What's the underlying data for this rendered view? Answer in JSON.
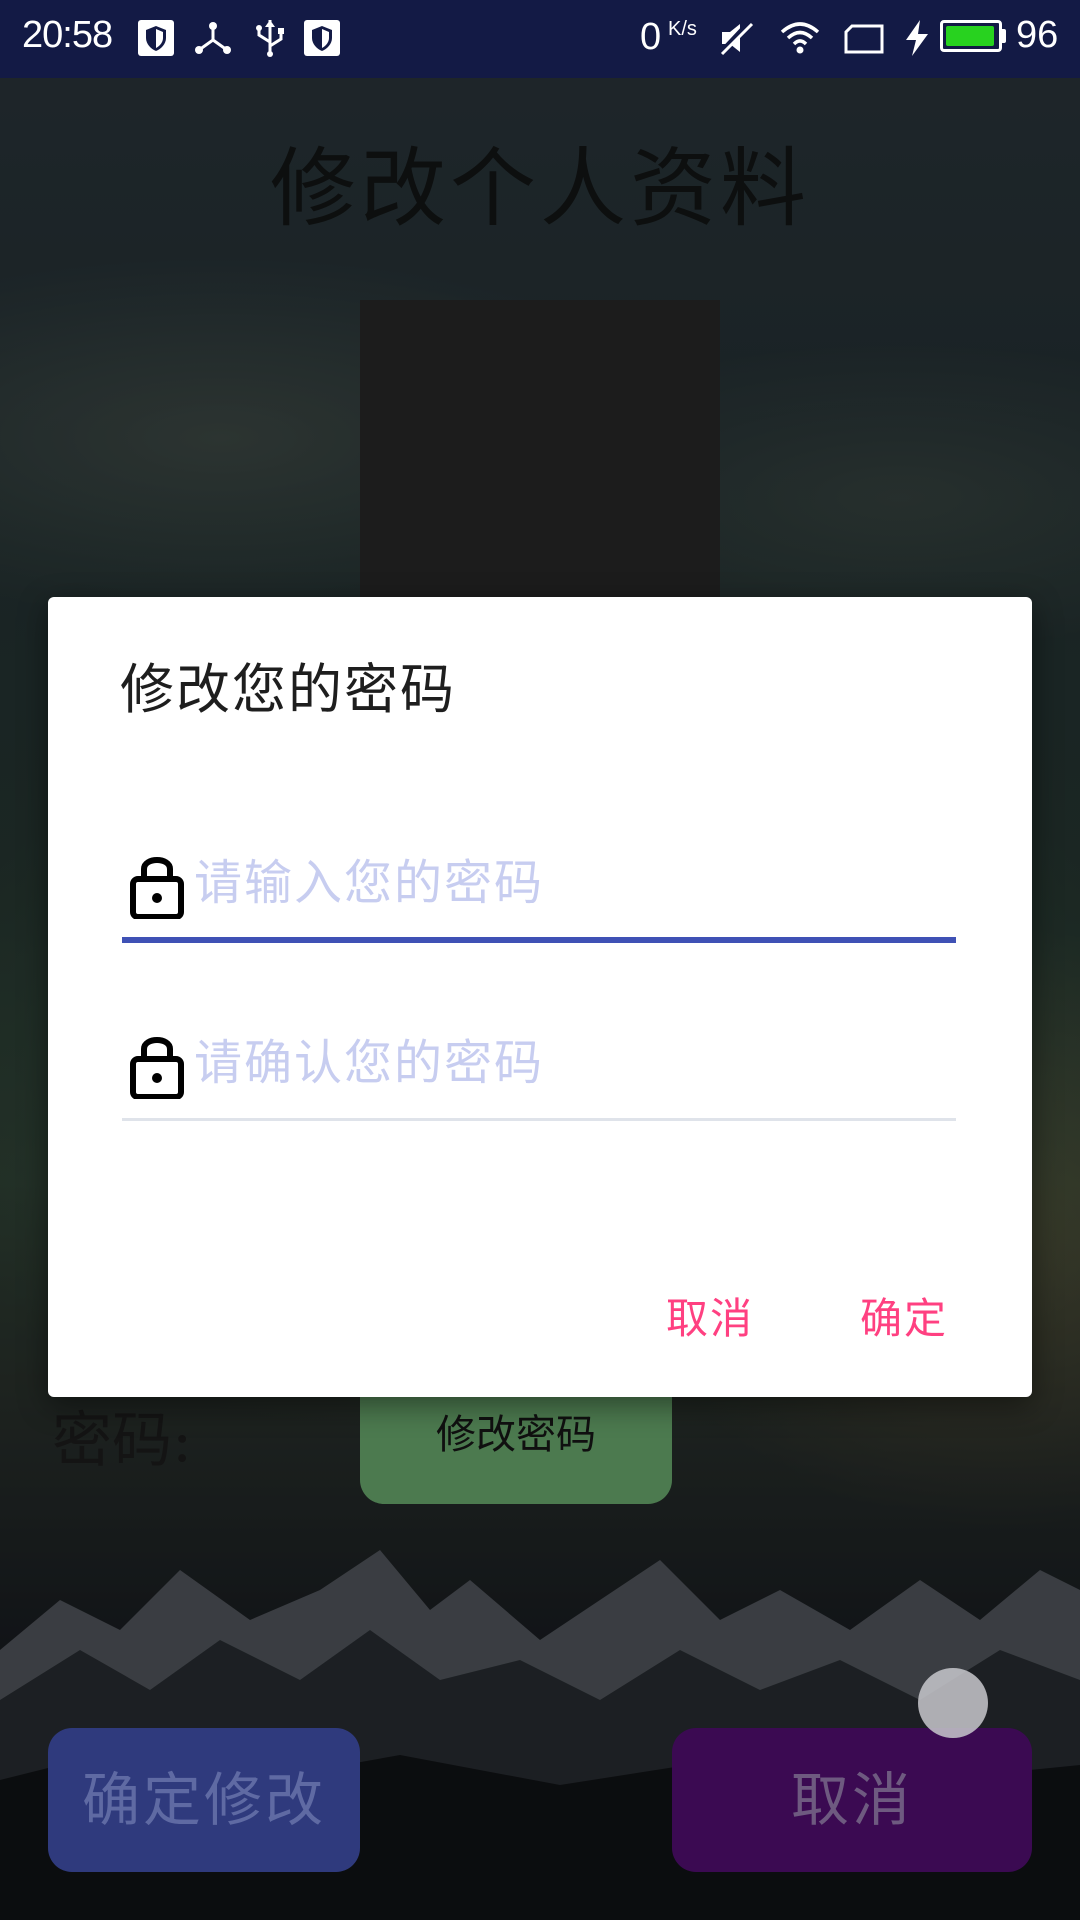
{
  "status_bar": {
    "time": "20:58",
    "net_speed": "0",
    "net_speed_unit": "K/s",
    "battery_percent": "96",
    "battery_level": 0.96,
    "battery_color": "#28d21f",
    "icons": [
      "shield-icon",
      "usb-share-icon",
      "usb-icon",
      "shield-icon",
      "mute-icon",
      "wifi-icon",
      "screen-icon",
      "charging-icon",
      "battery-icon"
    ]
  },
  "page": {
    "title": "修改个人资料",
    "password_label": "密码:",
    "change_password_button": "修改密码",
    "confirm_edit_button": "确定修改",
    "cancel_edit_button": "取消"
  },
  "dialog": {
    "title": "修改您的密码",
    "fields": [
      {
        "placeholder": "请输入您的密码",
        "value": "",
        "icon": "lock-icon"
      },
      {
        "placeholder": "请确认您的密码",
        "value": "",
        "icon": "lock-icon"
      }
    ],
    "cancel_label": "取消",
    "ok_label": "确定"
  },
  "colors": {
    "accent": "#ff4081",
    "primary": "#3f51b5",
    "status_bar": "#131a45"
  }
}
